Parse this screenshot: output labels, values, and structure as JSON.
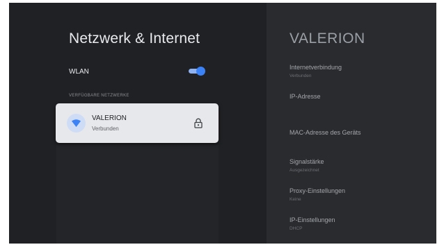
{
  "left": {
    "title": "Netzwerk & Internet",
    "wlan": {
      "label": "WLAN",
      "enabled": true
    },
    "section_label": "VERFÜGBARE NETZWERKE",
    "networks": [
      {
        "name": "VALERION",
        "status": "Verbunden",
        "icon": "wifi-icon",
        "secured_icon": "lock-icon"
      }
    ]
  },
  "right": {
    "title": "VALERION",
    "items": [
      {
        "label": "Internetverbindung",
        "value": "Verbunden"
      },
      {
        "label": "IP-Adresse",
        "value": ""
      },
      {
        "label": "MAC-Adresse des Geräts",
        "value": ""
      },
      {
        "label": "Signalstärke",
        "value": "Ausgezeichnet"
      },
      {
        "label": "Proxy-Einstellungen",
        "value": "Keine"
      },
      {
        "label": "IP-Einstellungen",
        "value": "DHCP"
      }
    ]
  },
  "colors": {
    "accent": "#3b82f6",
    "card_background": "#e7e8ec",
    "background": "#202124"
  }
}
